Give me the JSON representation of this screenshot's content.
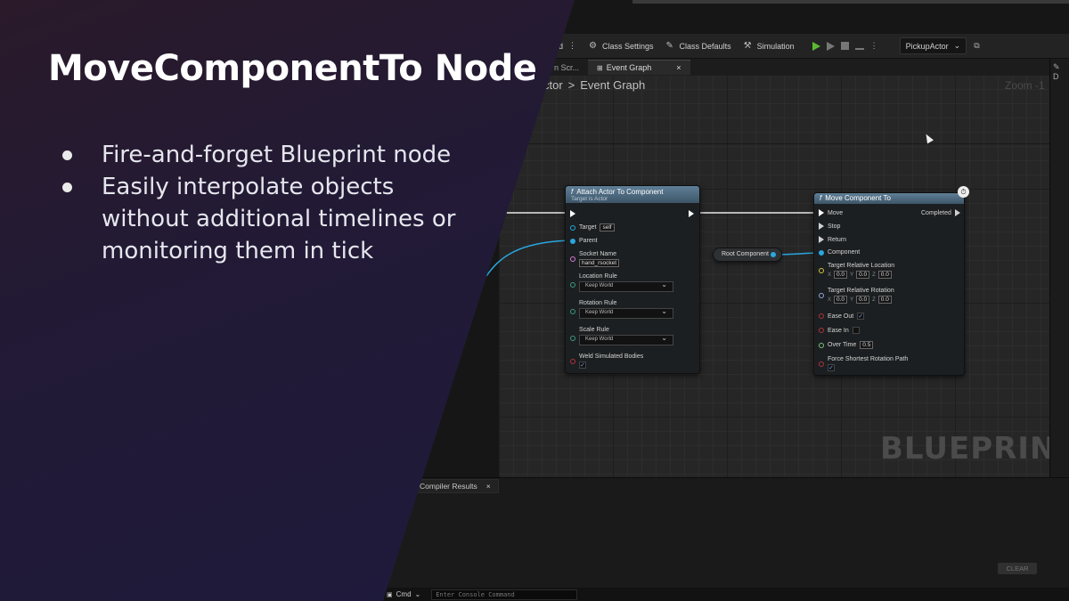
{
  "slide": {
    "title": "MoveComponentTo Node",
    "bullets": [
      "Fire-and-forget Blueprint node",
      "Easily interpolate objects without additional timelines or monitoring them in tick"
    ]
  },
  "toolbar": {
    "partial_label": "ed",
    "class_settings": "Class Settings",
    "class_defaults": "Class Defaults",
    "simulation": "Simulation",
    "actor_select": "PickupActor"
  },
  "tabs": {
    "partial": "n Scr...",
    "event_graph": "Event Graph",
    "close": "×",
    "right_partial": "D"
  },
  "breadcrumb": {
    "parent": "ctor",
    "separator": ">",
    "current": "Event Graph"
  },
  "graph": {
    "zoom": "Zoom -1",
    "watermark": "BLUEPRINT"
  },
  "attach_node": {
    "title": "Attach Actor To Component",
    "subtitle": "Target is Actor",
    "target_label": "Target",
    "target_value": "self",
    "parent_label": "Parent",
    "socket_label": "Socket Name",
    "socket_value": "hand_rsocket",
    "location_rule_label": "Location Rule",
    "location_rule_value": "Keep World",
    "rotation_rule_label": "Rotation Rule",
    "rotation_rule_value": "Keep World",
    "scale_rule_label": "Scale Rule",
    "scale_rule_value": "Keep World",
    "weld_label": "Weld Simulated Bodies"
  },
  "root_component": {
    "label": "Root Component"
  },
  "move_node": {
    "title": "Move Component To",
    "move_label": "Move",
    "completed_label": "Completed",
    "stop_label": "Stop",
    "return_label": "Return",
    "component_label": "Component",
    "loc_label": "Target Relative Location",
    "rot_label": "Target Relative Rotation",
    "x": "X",
    "y": "Y",
    "z": "Z",
    "loc_x": "0.0",
    "loc_y": "0.0",
    "loc_z": "0.0",
    "rot_x": "0.0",
    "rot_y": "0.0",
    "rot_z": "0.0",
    "ease_out_label": "Ease Out",
    "ease_in_label": "Ease In",
    "over_time_label": "Over Time",
    "over_time_value": "0.5",
    "force_label": "Force Shortest Rotation Path"
  },
  "bottom": {
    "compiler_results": "Compiler Results",
    "close": "×",
    "clear": "CLEAR",
    "cmd": "Cmd",
    "console_placeholder": "Enter Console Command"
  }
}
